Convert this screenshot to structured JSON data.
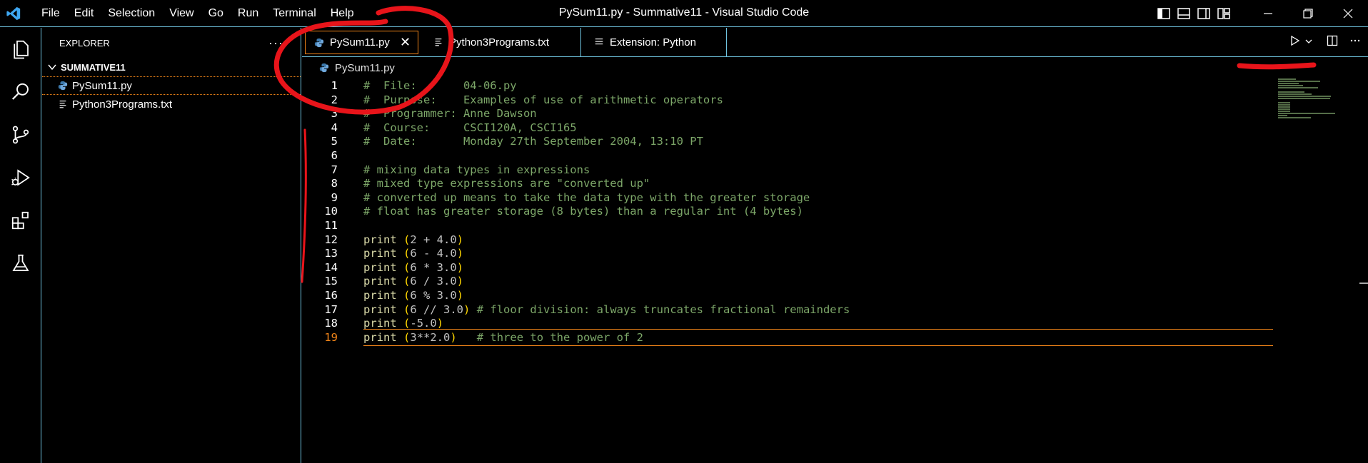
{
  "window": {
    "title": "PySum11.py - Summative11 - Visual Studio Code",
    "menu": [
      "File",
      "Edit",
      "Selection",
      "View",
      "Go",
      "Run",
      "Terminal",
      "Help"
    ]
  },
  "explorer": {
    "header": "EXPLORER",
    "more": "···",
    "folder": "SUMMATIVE11",
    "files": [
      {
        "name": "PySum11.py",
        "icon": "python-icon",
        "active": true
      },
      {
        "name": "Python3Programs.txt",
        "icon": "text-file-icon",
        "active": false
      }
    ]
  },
  "tabs": [
    {
      "label": "PySum11.py",
      "icon": "python-icon",
      "active": true,
      "close": "✕"
    },
    {
      "label": "Python3Programs.txt",
      "icon": "text-file-icon",
      "active": false
    },
    {
      "label": "Extension: Python",
      "icon": "extension-icon",
      "active": false
    }
  ],
  "breadcrumb": {
    "file": "PySum11.py"
  },
  "editor": {
    "current_line": 19,
    "lines": [
      "#  File:       04-06.py",
      "#  Purpose:    Examples of use of arithmetic operators",
      "#  Programmer: Anne Dawson",
      "#  Course:     CSCI120A, CSCI165",
      "#  Date:       Monday 27th September 2004, 13:10 PT",
      "",
      "# mixing data types in expressions",
      "# mixed type expressions are \"converted up\"",
      "# converted up means to take the data type with the greater storage",
      "# float has greater storage (8 bytes) than a regular int (4 bytes)",
      "",
      "print (2 + 4.0)",
      "print (6 - 4.0)",
      "print (6 * 3.0)",
      "print (6 / 3.0)",
      "print (6 % 3.0)",
      "print (6 // 3.0) # floor division: always truncates fractional remainders",
      "print (-5.0)",
      "print (3**2.0)   # three to the power of 2"
    ]
  },
  "colors": {
    "accent_border": "#6fc3df",
    "active_border": "#f38518",
    "comment": "#7ca668",
    "function": "#dcdcaa",
    "paren": "#ffd700",
    "annotation": "#e8141a"
  }
}
